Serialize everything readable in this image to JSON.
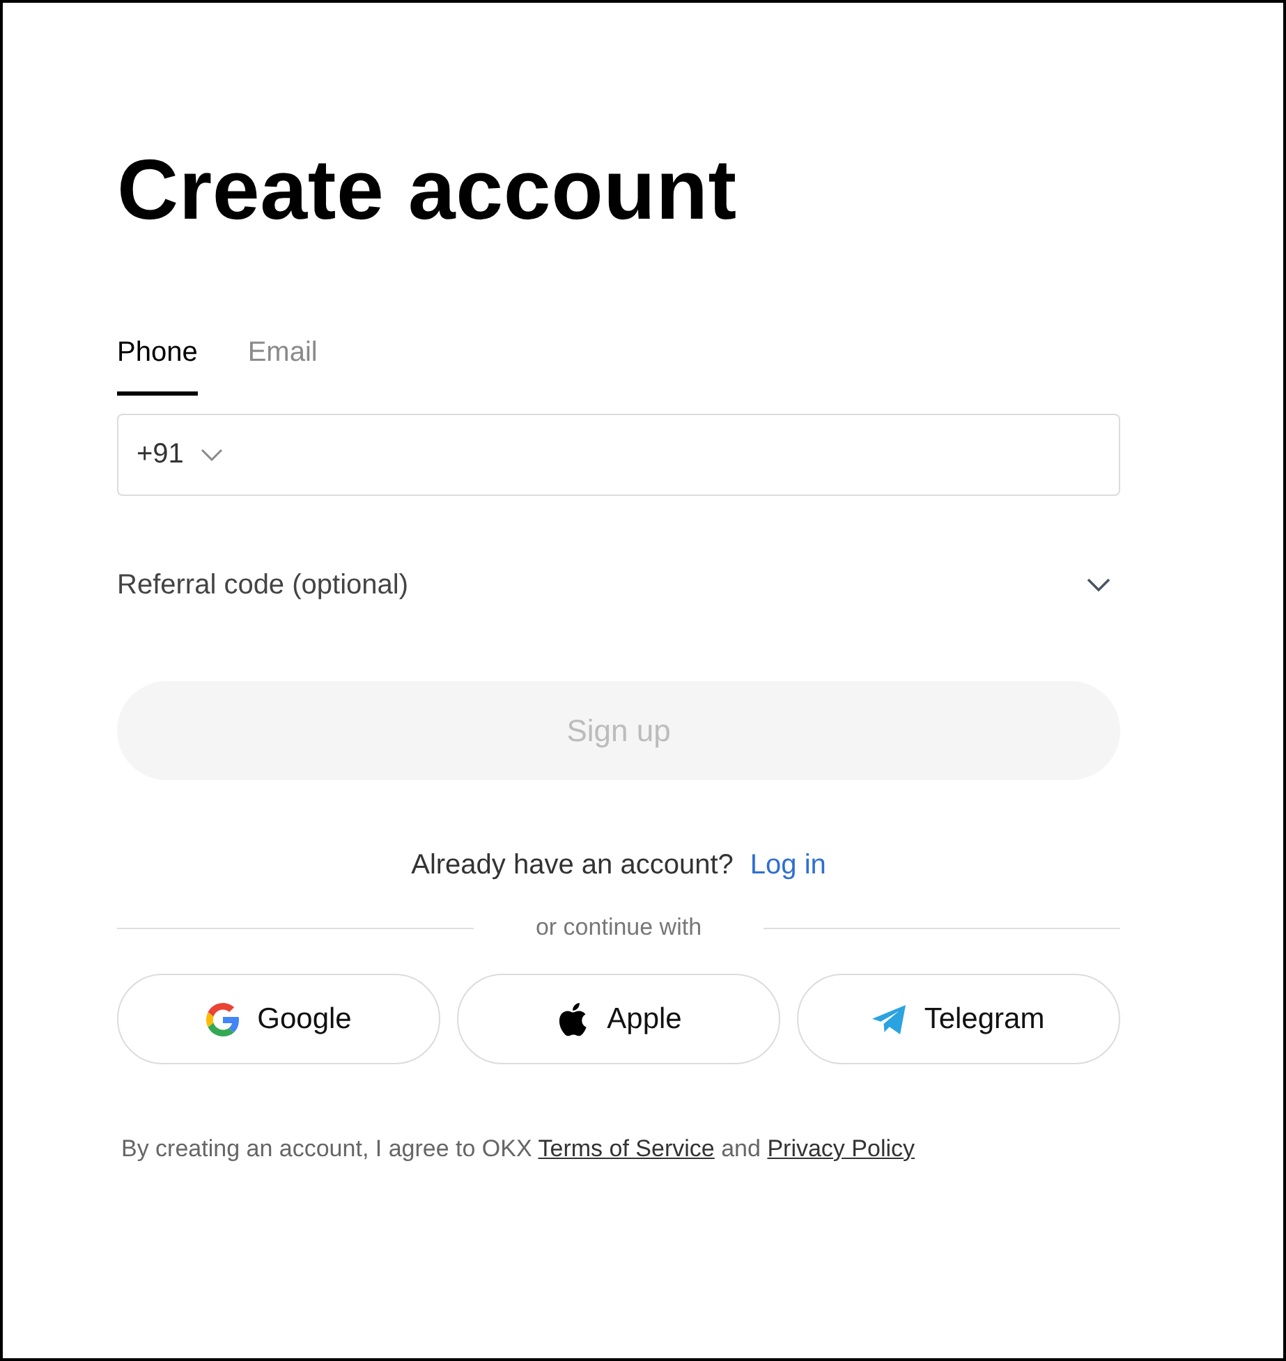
{
  "title": "Create account",
  "tabs": [
    {
      "label": "Phone",
      "selected": true
    },
    {
      "label": "Email",
      "selected": false
    }
  ],
  "phone_field": {
    "country_code": "+91"
  },
  "referral": {
    "label": "Referral code (optional)",
    "expanded": false
  },
  "sign_up_button": {
    "label": "Sign up",
    "disabled": true
  },
  "login_prompt": {
    "text": "Already have an account?",
    "link": "Log in"
  },
  "divider_label": "or continue with",
  "social_buttons": [
    {
      "kind": "google",
      "label": "Google"
    },
    {
      "kind": "apple",
      "label": "Apple"
    },
    {
      "kind": "telegram",
      "label": "Telegram"
    }
  ],
  "terms": {
    "text": "By creating an account, I agree to OKX",
    "terms_link": "Terms of Service",
    "joiner": "and",
    "privacy_link": "Privacy Policy"
  }
}
